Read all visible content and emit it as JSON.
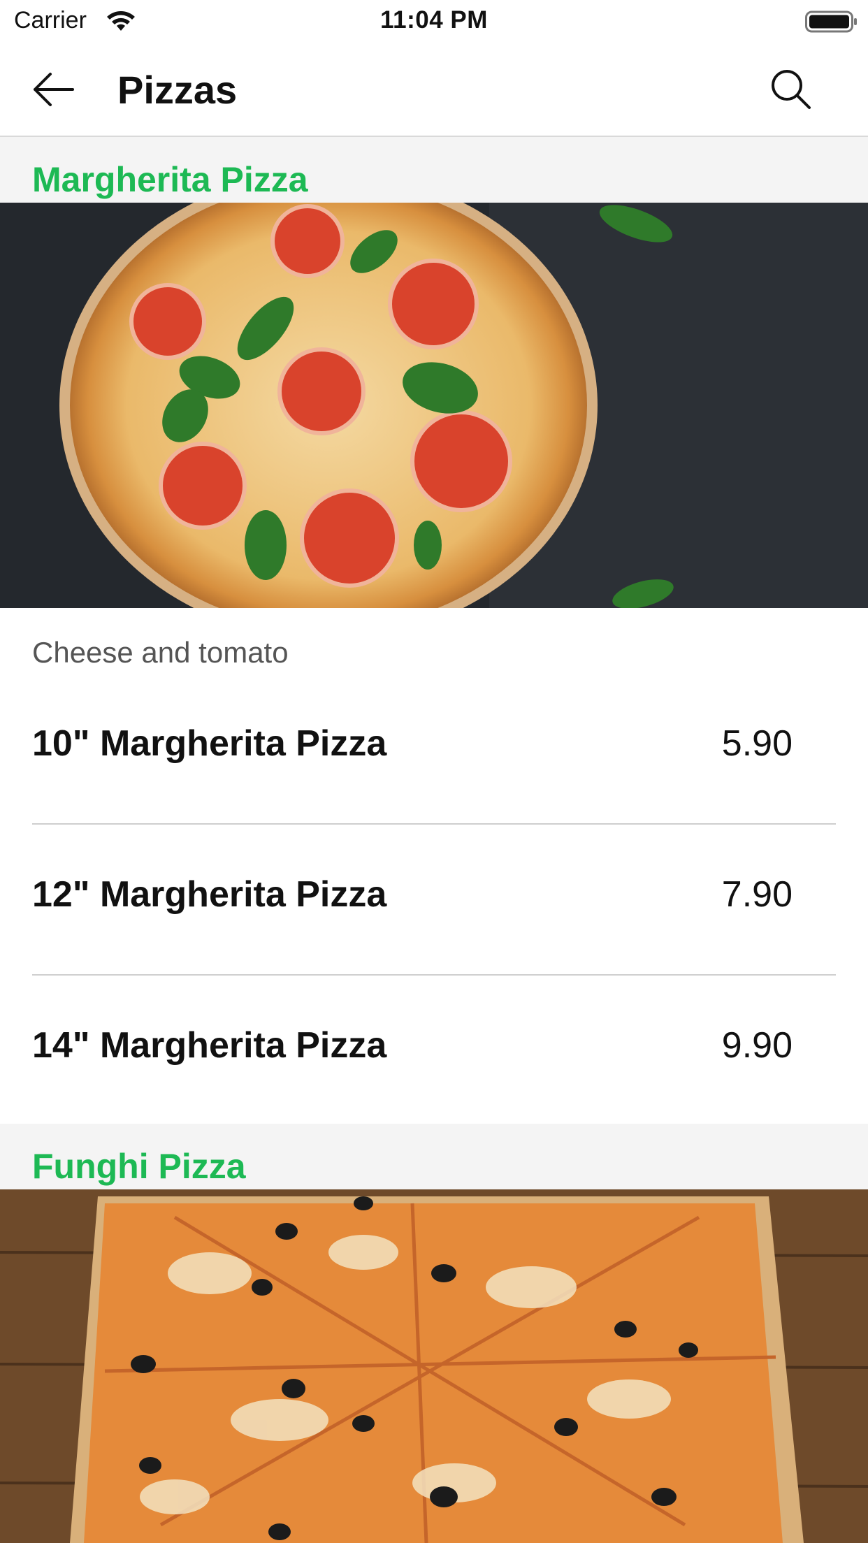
{
  "status_bar": {
    "carrier": "Carrier",
    "time": "11:04 PM",
    "icons": [
      "wifi-icon",
      "battery-icon"
    ]
  },
  "nav": {
    "title": "Pizzas",
    "back_icon": "arrow-left-icon",
    "search_icon": "search-icon"
  },
  "sections": [
    {
      "title": "Margherita Pizza",
      "description": "Cheese and tomato",
      "items": [
        {
          "name": "10\" Margherita Pizza",
          "price": "5.90"
        },
        {
          "name": "12\" Margherita Pizza",
          "price": "7.90"
        },
        {
          "name": "14\" Margherita Pizza",
          "price": "9.90"
        }
      ]
    },
    {
      "title": "Funghi Pizza"
    }
  ],
  "colors": {
    "accent": "#1db954",
    "section_bg": "#f4f4f4",
    "divider": "#cfcfcf"
  }
}
